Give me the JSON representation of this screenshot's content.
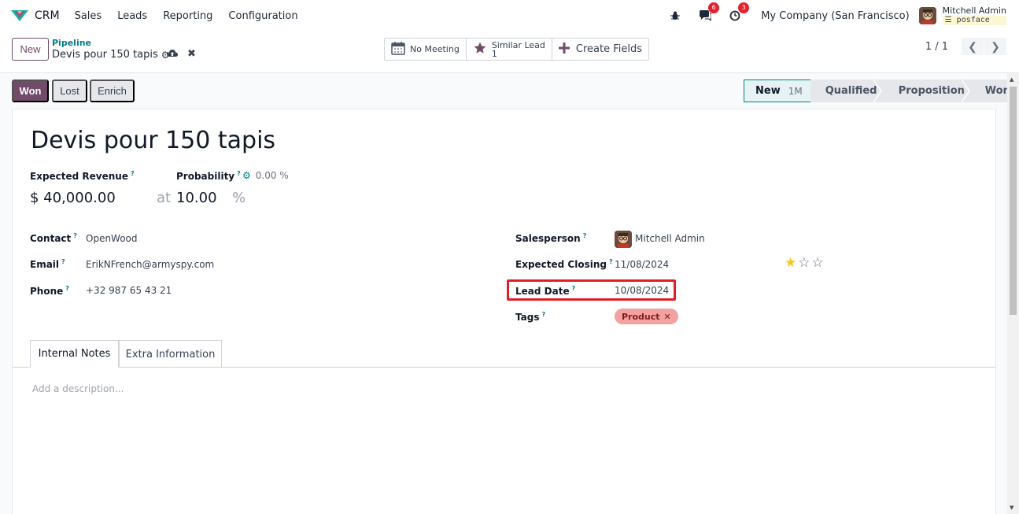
{
  "navbar": {
    "app_name": "CRM",
    "menu": [
      "Sales",
      "Leads",
      "Reporting",
      "Configuration"
    ],
    "messages_count": "6",
    "activities_count": "3",
    "company": "My Company (San Francisco)",
    "user_name": "Mitchell Admin",
    "user_db": "posface"
  },
  "control": {
    "new_label": "New",
    "breadcrumb_parent": "Pipeline",
    "breadcrumb_current": "Devis pour 150 tapis",
    "smart_buttons": {
      "meeting": "No Meeting",
      "similar_label": "Similar Lead",
      "similar_count": "1",
      "create_fields": "Create Fields"
    },
    "pager": "1 / 1"
  },
  "status": {
    "won": "Won",
    "lost": "Lost",
    "enrich": "Enrich",
    "stages": [
      "New",
      "Qualified",
      "Proposition",
      "Won"
    ],
    "active_stage_sub": "1M"
  },
  "form": {
    "title": "Devis pour 150 tapis",
    "expected_revenue_label": "Expected Revenue",
    "expected_revenue": "$ 40,000.00",
    "at": "at",
    "probability_label": "Probability",
    "probability_auto": "0.00 %",
    "probability": "10.00",
    "percent": "%",
    "contact_label": "Contact",
    "contact": "OpenWood",
    "email_label": "Email",
    "email": "ErikNFrench@armyspy.com",
    "phone_label": "Phone",
    "phone": "+32 987 65 43 21",
    "salesperson_label": "Salesperson",
    "salesperson": "Mitchell Admin",
    "expected_closing_label": "Expected Closing",
    "expected_closing": "11/08/2024",
    "priority_stars": 1,
    "lead_date_label": "Lead Date",
    "lead_date": "10/08/2024",
    "tags_label": "Tags",
    "tag": "Product",
    "help_mark": "?"
  },
  "tabs": {
    "internal_notes": "Internal Notes",
    "extra_information": "Extra Information"
  },
  "description_placeholder": "Add a description...",
  "colors": {
    "brand": "#714b67",
    "teal": "#017e84",
    "highlight": "#e11d26",
    "tag": "#f4a1a1",
    "star": "#f3c623"
  }
}
